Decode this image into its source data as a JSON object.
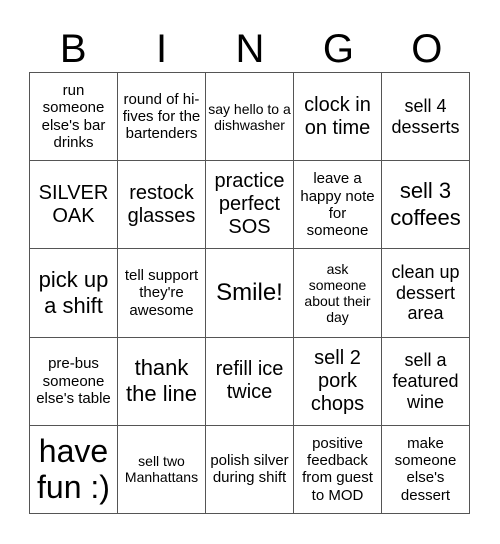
{
  "header": {
    "letters": [
      "B",
      "I",
      "N",
      "G",
      "O"
    ]
  },
  "cells": [
    "run someone else's bar drinks",
    "round of hi-fives for the bartenders",
    "say hello to a dishwasher",
    "clock in on time",
    "sell 4 desserts",
    "SILVER OAK",
    "restock glasses",
    "practice perfect SOS",
    "leave a happy note for someone",
    "sell 3 coffees",
    "pick up a shift",
    "tell support they're awesome",
    "Smile!",
    "ask someone about their day",
    "clean up dessert area",
    "pre-bus someone else's table",
    "thank the line",
    "refill ice twice",
    "sell 2 pork chops",
    "sell a featured wine",
    "have fun :)",
    "sell two Manhattans",
    "polish silver during shift",
    "positive feedback from guest to MOD",
    "make someone else's dessert"
  ]
}
